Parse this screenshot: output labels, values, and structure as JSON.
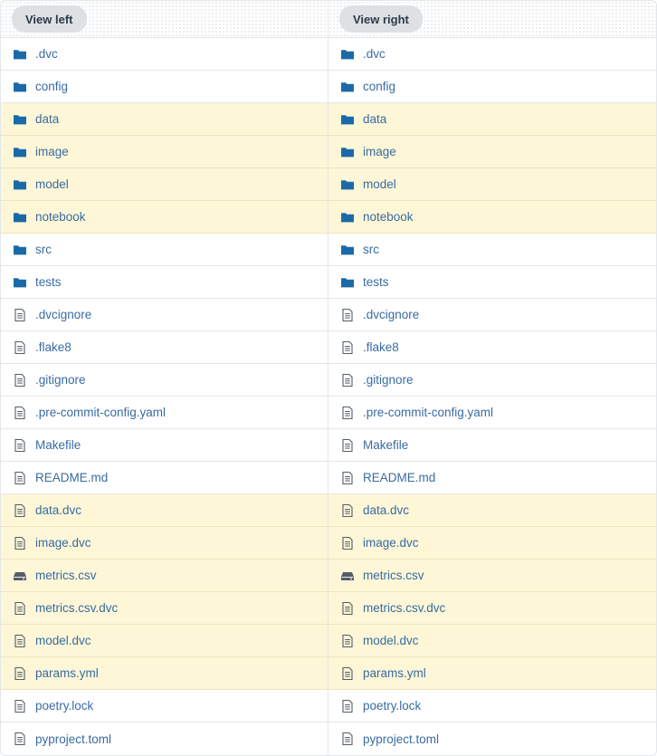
{
  "left": {
    "button_label": "View left"
  },
  "right": {
    "button_label": "View right"
  },
  "colors": {
    "changed_row": "#fdf6d7",
    "link": "#3a6ba1",
    "folder_icon": "#1a6aa8",
    "file_icon": "#555e66"
  },
  "rows": [
    {
      "name": ".dvc",
      "icon": "folder-icon",
      "changed": false
    },
    {
      "name": "config",
      "icon": "folder-icon",
      "changed": false
    },
    {
      "name": "data",
      "icon": "folder-icon",
      "changed": true
    },
    {
      "name": "image",
      "icon": "folder-icon",
      "changed": true
    },
    {
      "name": "model",
      "icon": "folder-icon",
      "changed": true
    },
    {
      "name": "notebook",
      "icon": "folder-icon",
      "changed": true
    },
    {
      "name": "src",
      "icon": "folder-icon",
      "changed": false
    },
    {
      "name": "tests",
      "icon": "folder-icon",
      "changed": false
    },
    {
      "name": ".dvcignore",
      "icon": "file-icon",
      "changed": false
    },
    {
      "name": ".flake8",
      "icon": "file-icon",
      "changed": false
    },
    {
      "name": ".gitignore",
      "icon": "file-icon",
      "changed": false
    },
    {
      "name": ".pre-commit-config.yaml",
      "icon": "file-icon",
      "changed": false
    },
    {
      "name": "Makefile",
      "icon": "file-icon",
      "changed": false
    },
    {
      "name": "README.md",
      "icon": "file-icon",
      "changed": false
    },
    {
      "name": "data.dvc",
      "icon": "file-icon",
      "changed": true
    },
    {
      "name": "image.dvc",
      "icon": "file-icon",
      "changed": true
    },
    {
      "name": "metrics.csv",
      "icon": "storage-icon",
      "changed": true
    },
    {
      "name": "metrics.csv.dvc",
      "icon": "file-icon",
      "changed": true
    },
    {
      "name": "model.dvc",
      "icon": "file-icon",
      "changed": true
    },
    {
      "name": "params.yml",
      "icon": "file-icon",
      "changed": true
    },
    {
      "name": "poetry.lock",
      "icon": "file-icon",
      "changed": false
    },
    {
      "name": "pyproject.toml",
      "icon": "file-icon",
      "changed": false
    }
  ]
}
